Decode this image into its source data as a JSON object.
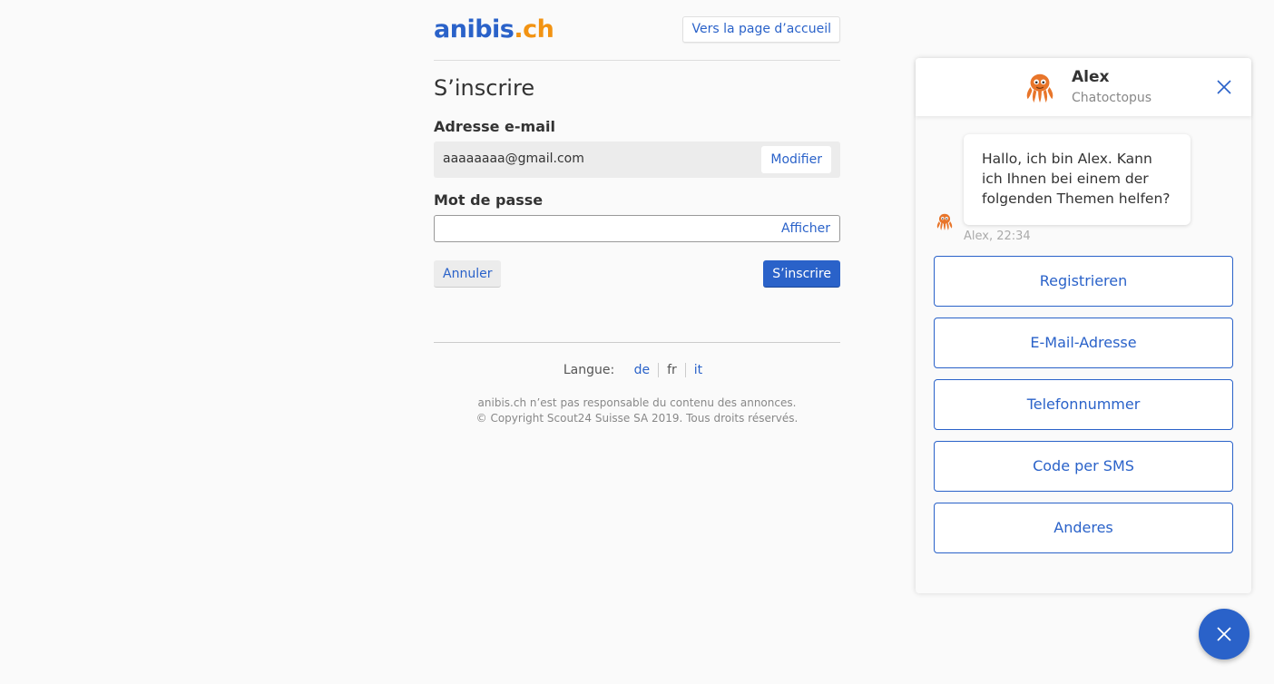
{
  "header": {
    "logo_main": "anibis",
    "logo_tld": ".ch",
    "home_link": "Vers la page d’accueil"
  },
  "form": {
    "title": "S’inscrire",
    "email_label": "Adresse e-mail",
    "email_value": "aaaaaaaa@gmail.com",
    "modify_label": "Modifier",
    "password_label": "Mot de passe",
    "password_value": "",
    "show_label": "Afficher",
    "cancel_label": "Annuler",
    "submit_label": "S’inscrire"
  },
  "footer": {
    "language_label": "Langue:",
    "languages": [
      "de",
      "fr",
      "it"
    ],
    "current_language": "fr",
    "disclaimer": "anibis.ch n’est pas responsable du contenu des annonces.",
    "copyright": "© Copyright Scout24 Suisse SA 2019. Tous droits réservés."
  },
  "chat": {
    "agent_name": "Alex",
    "agent_subtitle": "Chatoctopus",
    "message": "Hallo, ich bin Alex. Kann ich Ihnen bei einem der folgenden Themen helfen?",
    "message_meta": "Alex, 22:34",
    "options": [
      "Registrieren",
      "E-Mail-Adresse",
      "Telefonnummer",
      "Code per SMS",
      "Anderes"
    ],
    "close_icon": "close-icon",
    "avatar_icon": "octopus-icon"
  },
  "colors": {
    "brand_blue": "#2a62c9",
    "brand_orange": "#f29312",
    "background": "#fafafa"
  }
}
